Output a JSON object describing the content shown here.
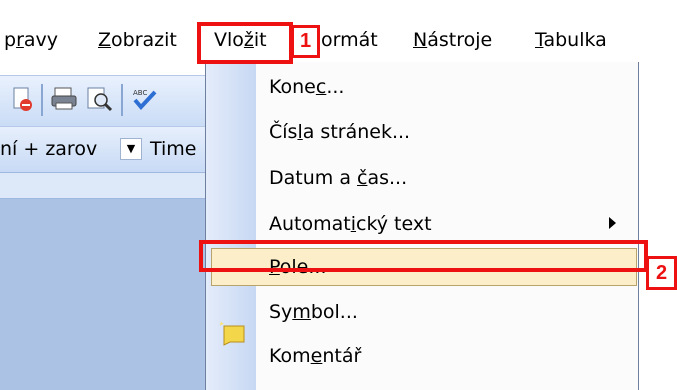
{
  "menubar": {
    "items": [
      {
        "pre": "p",
        "u": "r",
        "post": "avy"
      },
      {
        "pre": "",
        "u": "Z",
        "post": "obrazit"
      },
      {
        "pre": "Vlo",
        "u": "ž",
        "post": "it"
      },
      {
        "pre": "",
        "u": "",
        "post": "ormát"
      },
      {
        "pre": "",
        "u": "N",
        "post": "ástroje"
      },
      {
        "pre": "",
        "u": "T",
        "post": "abulka"
      }
    ]
  },
  "toolbar": {
    "style_value": "ní + zarov",
    "font_value": "Time"
  },
  "menu": {
    "items": [
      {
        "pre": "Kone",
        "u": "c",
        "post": "..."
      },
      {
        "pre": "Čís",
        "u": "l",
        "post": "a stránek..."
      },
      {
        "pre": "Datum a ",
        "u": "č",
        "post": "as..."
      },
      {
        "pre": "Automat",
        "u": "i",
        "post": "cký text"
      },
      {
        "pre": "",
        "u": "P",
        "post": "ole..."
      },
      {
        "pre": "Sy",
        "u": "m",
        "post": "bol..."
      },
      {
        "pre": "Kom",
        "u": "e",
        "post": "ntář"
      }
    ]
  },
  "annotations": {
    "step1": "1",
    "step2": "2"
  },
  "colors": {
    "annotation": "#ee1111",
    "highlight": "#fbeec9"
  }
}
